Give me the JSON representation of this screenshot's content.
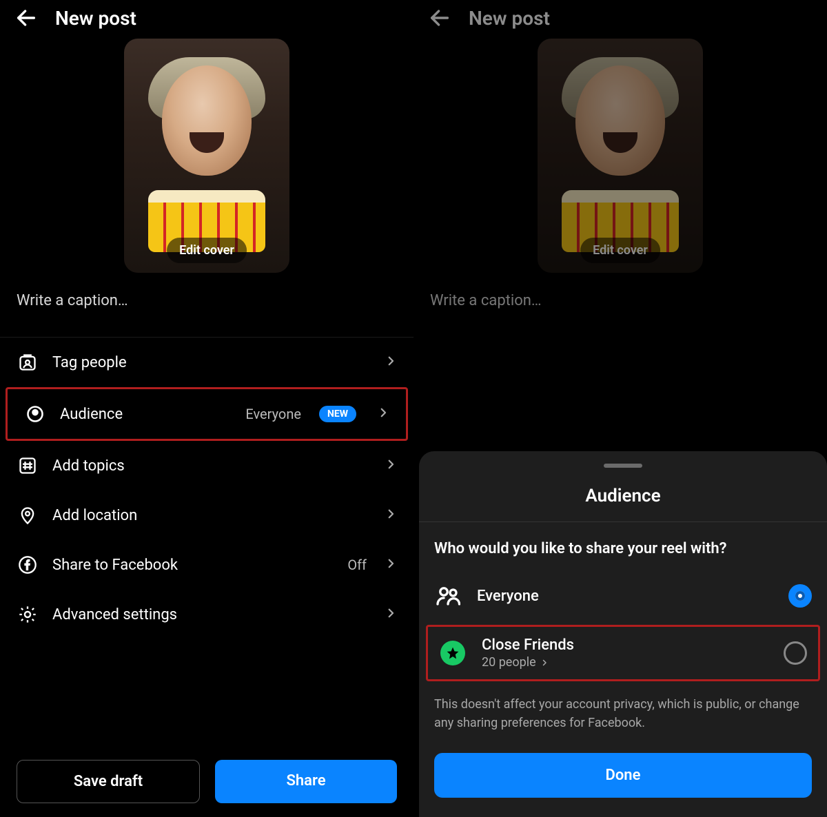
{
  "left": {
    "header_title": "New post",
    "edit_cover": "Edit cover",
    "caption_placeholder": "Write a caption…",
    "rows": {
      "tag_people": "Tag people",
      "audience": "Audience",
      "audience_value": "Everyone",
      "audience_badge": "NEW",
      "add_topics": "Add topics",
      "add_location": "Add location",
      "share_fb": "Share to Facebook",
      "share_fb_value": "Off",
      "advanced": "Advanced settings"
    },
    "footer": {
      "save_draft": "Save draft",
      "share": "Share"
    }
  },
  "right": {
    "header_title": "New post",
    "edit_cover": "Edit cover",
    "caption_placeholder": "Write a caption…",
    "modal": {
      "title": "Audience",
      "subtitle": "Who would you like to share your reel with?",
      "everyone": "Everyone",
      "close_friends": "Close Friends",
      "close_friends_sub": "20 people",
      "disclaimer": "This doesn't affect your account privacy, which is public, or change any sharing preferences for Facebook.",
      "done": "Done"
    }
  }
}
